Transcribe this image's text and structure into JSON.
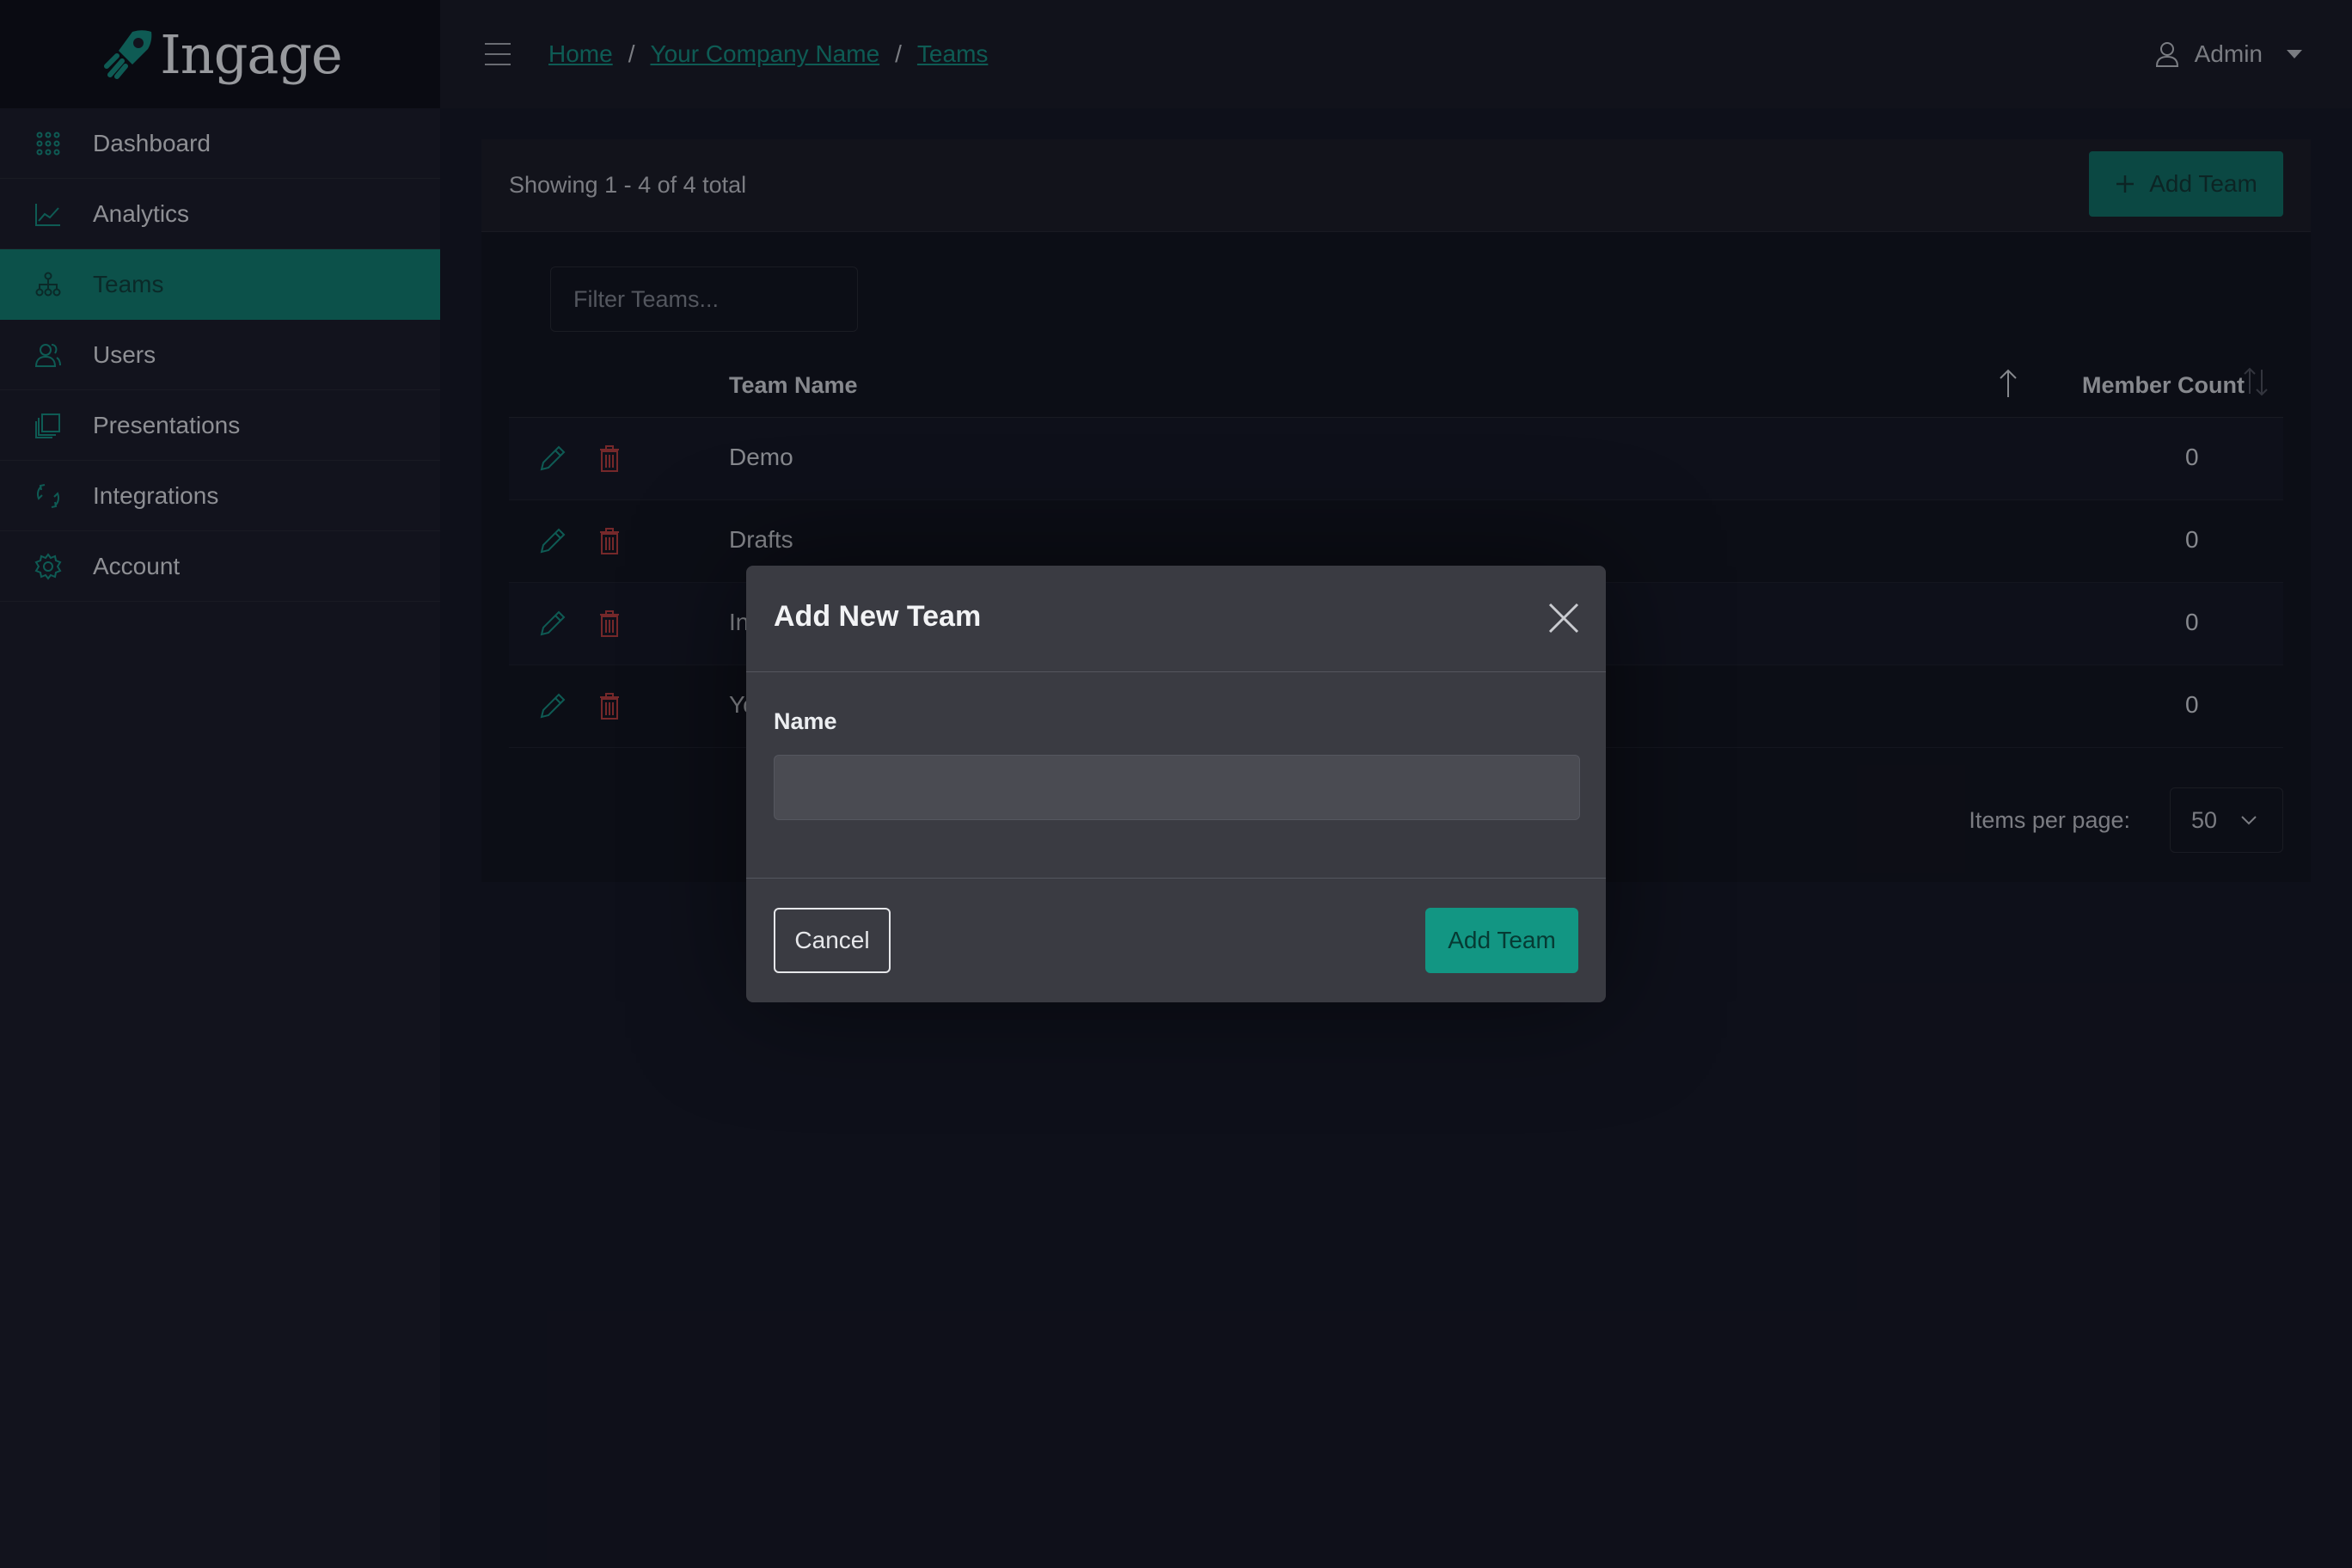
{
  "app": {
    "name": "Ingage"
  },
  "sidebar": {
    "items": [
      {
        "label": "Dashboard",
        "icon": "grid-icon"
      },
      {
        "label": "Analytics",
        "icon": "chart-line-icon"
      },
      {
        "label": "Teams",
        "icon": "org-chart-icon",
        "active": true
      },
      {
        "label": "Users",
        "icon": "users-icon"
      },
      {
        "label": "Presentations",
        "icon": "slides-icon"
      },
      {
        "label": "Integrations",
        "icon": "sync-icon"
      },
      {
        "label": "Account",
        "icon": "gear-icon"
      }
    ]
  },
  "header": {
    "breadcrumb": [
      "Home",
      "Your Company Name",
      "Teams"
    ],
    "separator": "/",
    "user": "Admin"
  },
  "card": {
    "summary": "Showing 1 - 4 of 4 total",
    "add_button": "Add Team",
    "filter_placeholder": "Filter Teams...",
    "columns": {
      "name": "Team Name",
      "count": "Member Count"
    },
    "rows": [
      {
        "name": "Demo",
        "count": "0"
      },
      {
        "name": "Drafts",
        "count": "0"
      },
      {
        "name": "In",
        "count": "0"
      },
      {
        "name": "Yo",
        "count": "0"
      }
    ],
    "pager": {
      "label": "Items per page:",
      "value": "50"
    }
  },
  "modal": {
    "title": "Add New Team",
    "field_label": "Name",
    "field_value": "",
    "cancel": "Cancel",
    "submit": "Add Team"
  },
  "colors": {
    "accent": "#12887a",
    "active_nav": "#0e786b",
    "danger": "#b03a3a",
    "background": "#121421"
  }
}
